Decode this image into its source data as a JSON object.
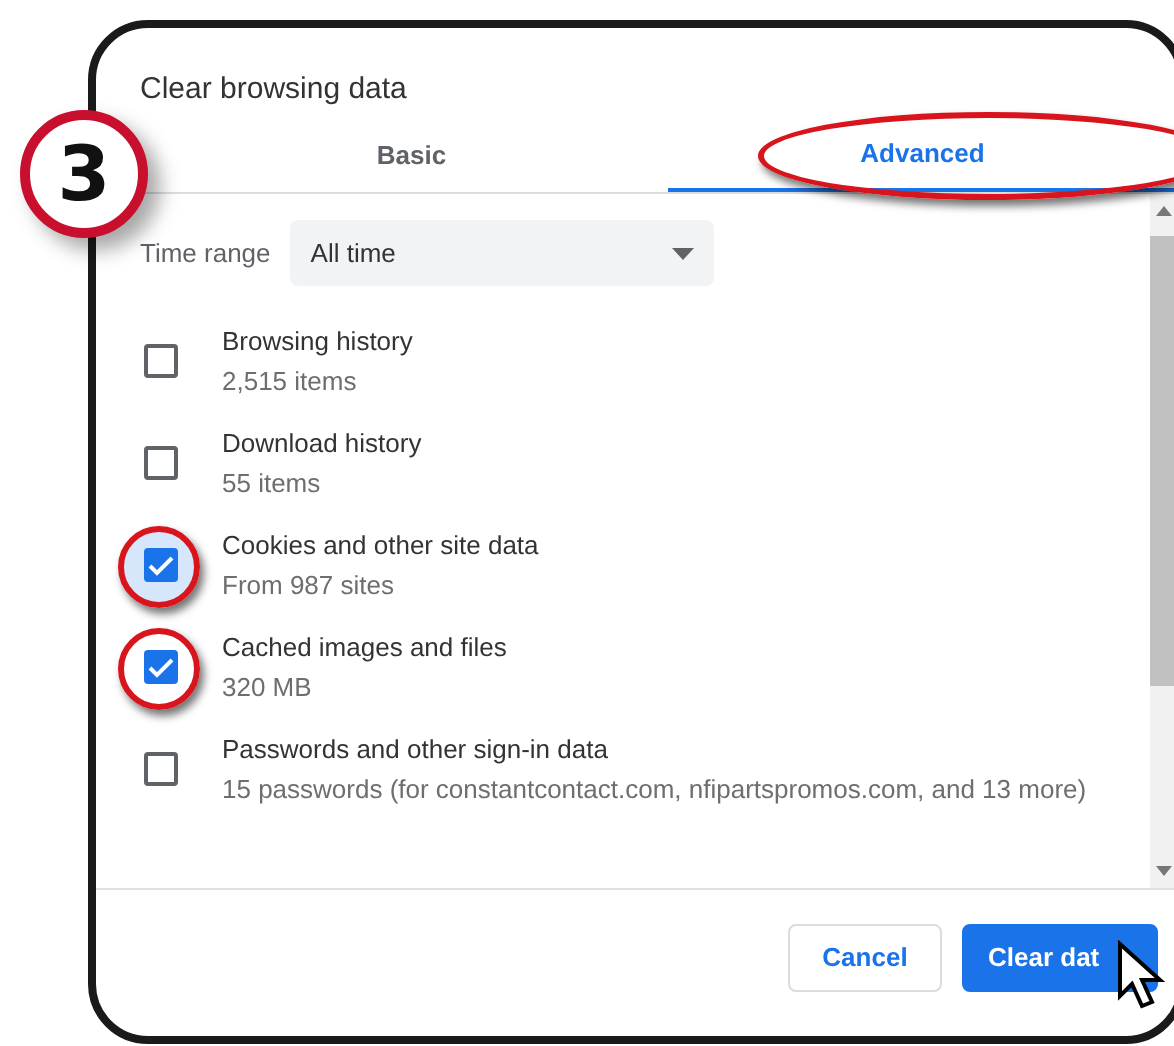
{
  "step_badge": "3",
  "dialog": {
    "title": "Clear browsing data",
    "tabs": [
      {
        "label": "Basic",
        "selected": false,
        "highlighted": false
      },
      {
        "label": "Advanced",
        "selected": true,
        "highlighted": true
      }
    ],
    "time_range": {
      "label": "Time range",
      "value": "All time"
    },
    "items": [
      {
        "label": "Browsing history",
        "detail": "2,515 items",
        "checked": false,
        "highlighted": false
      },
      {
        "label": "Download history",
        "detail": "55 items",
        "checked": false,
        "highlighted": false
      },
      {
        "label": "Cookies and other site data",
        "detail": "From 987 sites",
        "checked": true,
        "highlighted": true
      },
      {
        "label": "Cached images and files",
        "detail": "320 MB",
        "checked": true,
        "highlighted": true
      },
      {
        "label": "Passwords and other sign-in data",
        "detail": "15 passwords (for constantcontact.com, nfipartspromos.com, and 13 more)",
        "checked": false,
        "highlighted": false
      }
    ],
    "buttons": [
      {
        "label": "Cancel",
        "kind": "secondary"
      },
      {
        "label": "Clear dat",
        "kind": "primary"
      }
    ]
  }
}
